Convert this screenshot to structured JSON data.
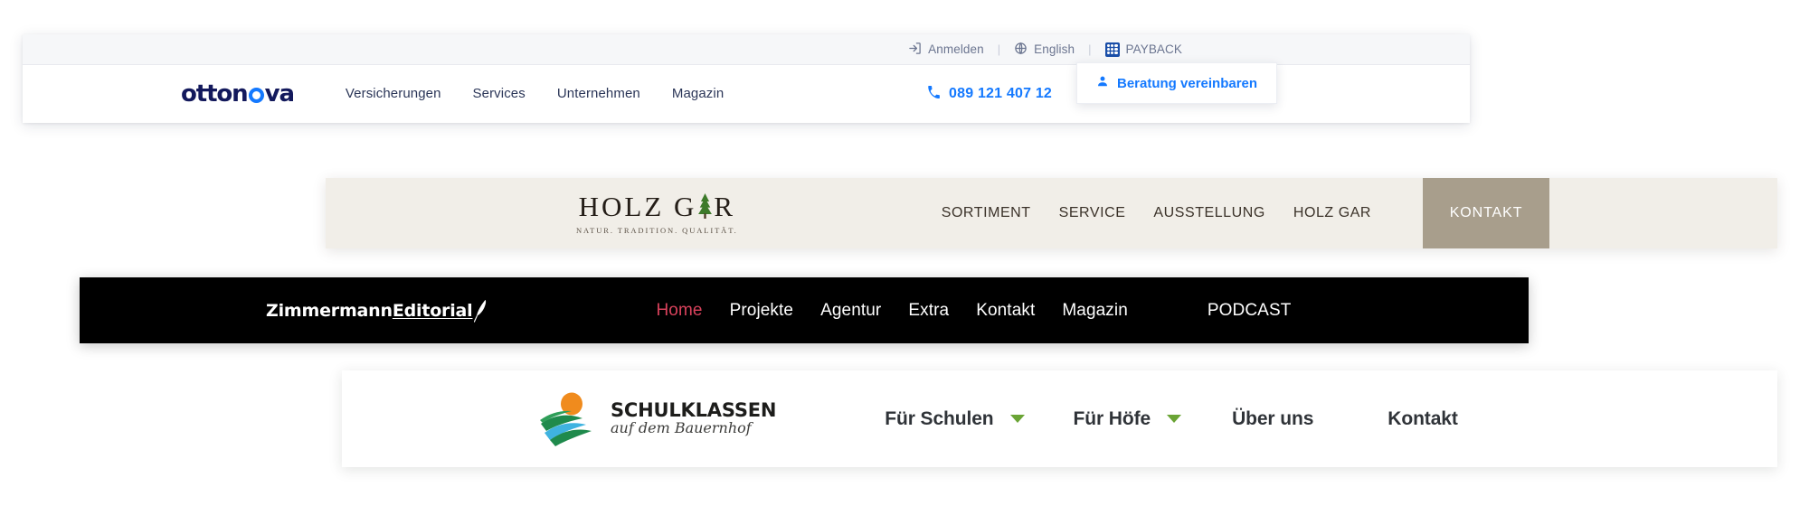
{
  "page": {
    "background": "#ffffff",
    "description": "Four website navigation bar screenshots stacked vertically"
  },
  "navbars": [
    {
      "id": "ottonova",
      "brand": "ottonova",
      "brand_colors": {
        "text": "#13195c",
        "accent": "#1479ff"
      },
      "utility_bar": {
        "background": "#f6f7f9",
        "items": [
          {
            "label": "Anmelden",
            "icon": "login-icon"
          },
          {
            "label": "English",
            "icon": "globe-icon"
          },
          {
            "label": "PAYBACK",
            "icon": "payback-icon"
          }
        ],
        "separator": "|"
      },
      "nav_links": [
        "Versicherungen",
        "Services",
        "Unternehmen",
        "Magazin"
      ],
      "phone": {
        "number": "089 121 407 12",
        "icon": "phone-icon"
      },
      "cta": {
        "label": "Beratung vereinbaren",
        "icon": "user-icon"
      }
    },
    {
      "id": "holzgar",
      "background": "#f1eee8",
      "logo": {
        "word_before": "HOLZ G",
        "word_after": "R",
        "tree_icon": "fir-tree-icon",
        "tagline": "NATUR. TRADITION. QUALITÄT."
      },
      "nav_links": [
        "SORTIMENT",
        "SERVICE",
        "AUSSTELLUNG",
        "HOLZ GAR"
      ],
      "cta": {
        "label": "KONTAKT",
        "background": "#a89e8c",
        "color": "#ffffff"
      }
    },
    {
      "id": "zimmermann-editorial",
      "background": "#000000",
      "logo": {
        "part_one": "Zimmermann",
        "part_two": "Editorial",
        "icon": "quill-feather-icon"
      },
      "nav_links": [
        {
          "label": "Home",
          "active": true,
          "color": "#d9425c"
        },
        {
          "label": "Projekte",
          "active": false
        },
        {
          "label": "Agentur",
          "active": false
        },
        {
          "label": "Extra",
          "active": false
        },
        {
          "label": "Kontakt",
          "active": false
        },
        {
          "label": "Magazin",
          "active": false
        }
      ],
      "secondary_link": {
        "label": "PODCAST",
        "color": "#b9b9b9"
      }
    },
    {
      "id": "schulklassen",
      "background": "#ffffff",
      "logo": {
        "title": "SCHULKLASSEN",
        "subtitle": "auf dem Bauernhof",
        "icon": "farm-sun-field-icon",
        "colors": {
          "sun": "#f08b1d",
          "field": "#1f8a4c",
          "stream": "#3fb3e0"
        }
      },
      "nav_links": [
        {
          "label": "Für Schulen",
          "has_dropdown": true
        },
        {
          "label": "Für Höfe",
          "has_dropdown": true
        },
        {
          "label": "Über uns",
          "has_dropdown": false
        },
        {
          "label": "Kontakt",
          "has_dropdown": false
        }
      ],
      "caret_color": "#6aa435"
    }
  ]
}
